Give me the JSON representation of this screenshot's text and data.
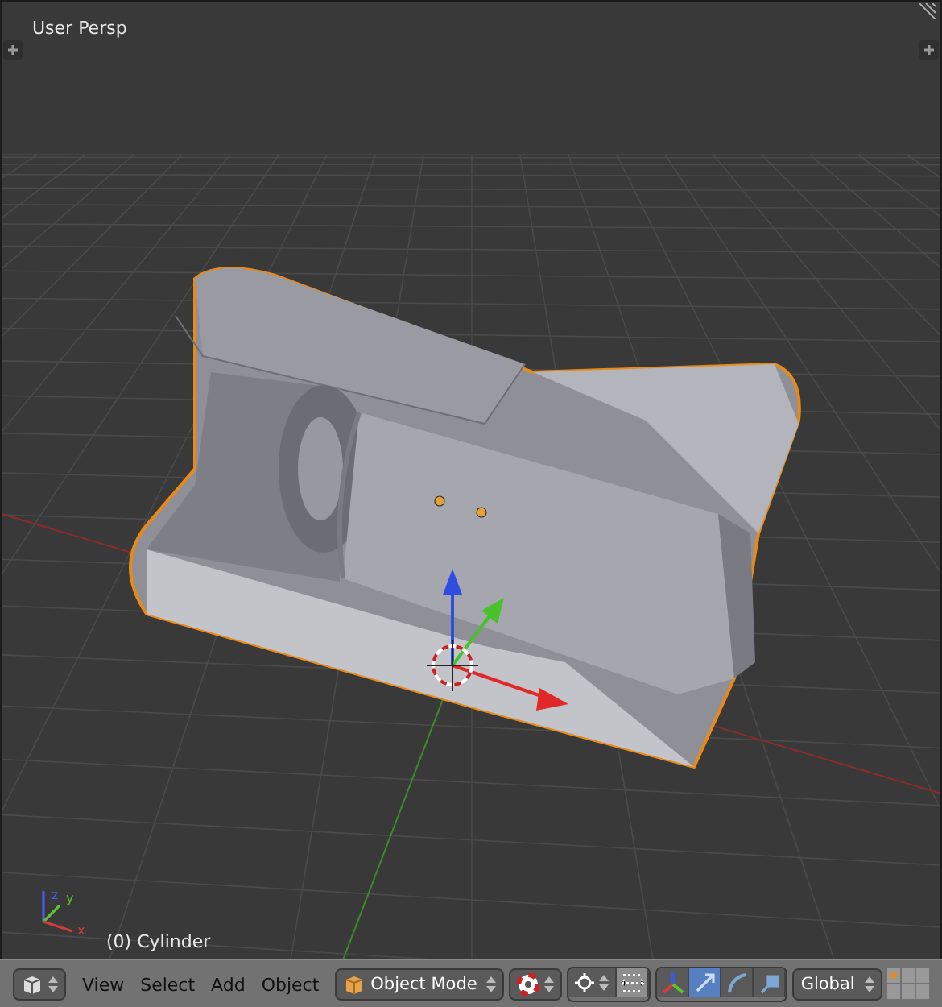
{
  "viewport": {
    "title": "User Persp",
    "object_label": "(0) Cylinder",
    "axis_labels": [
      {
        "kind": "x",
        "text": "x"
      },
      {
        "kind": "y",
        "text": "y"
      },
      {
        "kind": "z",
        "text": "z"
      }
    ]
  },
  "header": {
    "menus": [
      "View",
      "Select",
      "Add",
      "Object"
    ],
    "mode": "Object Mode",
    "manipulator_on": true,
    "manipulators": [
      {
        "kind": "translate",
        "selected": true
      },
      {
        "kind": "rotate",
        "selected": false
      },
      {
        "kind": "scale",
        "selected": false
      }
    ],
    "orientation": "Global"
  }
}
